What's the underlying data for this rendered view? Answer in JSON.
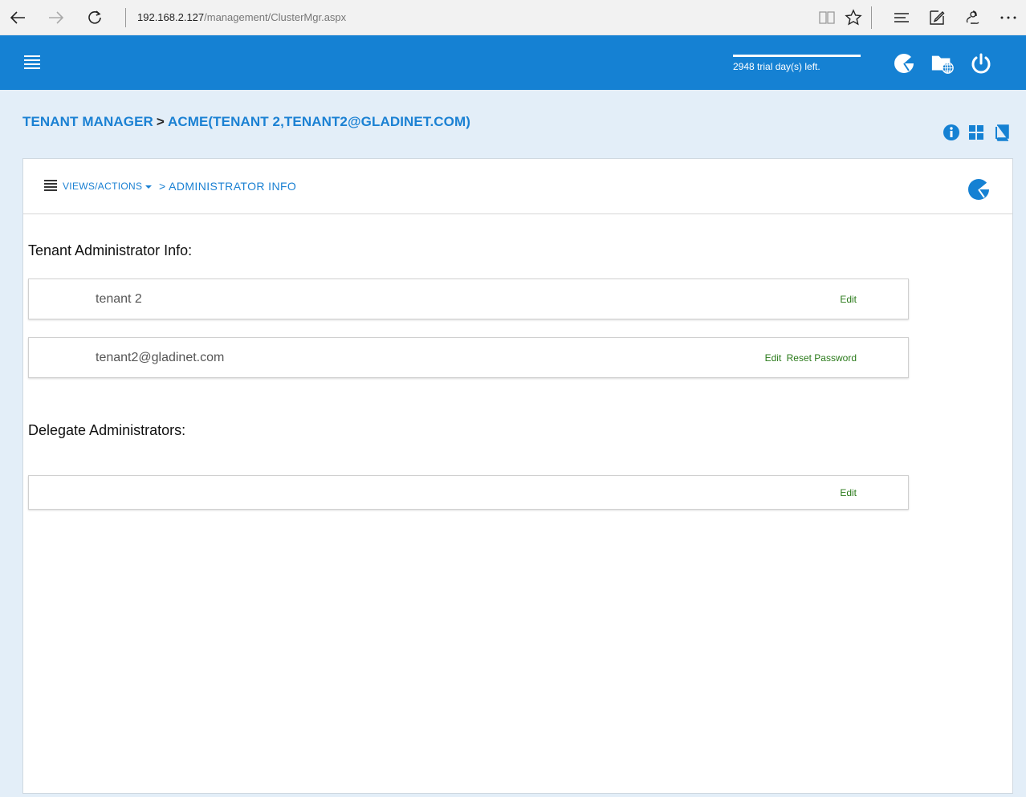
{
  "browser": {
    "address_host": "192.168.2.127",
    "address_path": "/management/ClusterMgr.aspx"
  },
  "header": {
    "trial_text": "2948 trial day(s) left.",
    "trial_progress": 1.0
  },
  "breadcrumb": {
    "root": "TENANT MANAGER",
    "separator": ">",
    "current": "ACME(TENANT 2,TENANT2@GLADINET.COM)"
  },
  "panel": {
    "views_actions": "VIEWS/ACTIONS",
    "section_crumb": "> ADMINISTRATOR INFO",
    "tenant_admin_title": "Tenant Administrator Info:",
    "admin_name": "tenant 2",
    "admin_email": "tenant2@gladinet.com",
    "edit_label": "Edit",
    "reset_password_label": "Reset Password",
    "delegate_title": "Delegate Administrators:"
  },
  "colors": {
    "brand_blue": "#1581d3",
    "action_green": "#2a7a1a"
  },
  "icons": [
    "back-icon",
    "forward-icon",
    "refresh-icon",
    "reading-view-icon",
    "favorite-star-icon",
    "hub-icon",
    "web-note-icon",
    "share-icon",
    "more-icon",
    "hamburger-icon",
    "dashboard-pie-icon",
    "folder-web-icon",
    "power-icon",
    "info-icon",
    "tiles-icon",
    "book-icon",
    "list-icon"
  ]
}
